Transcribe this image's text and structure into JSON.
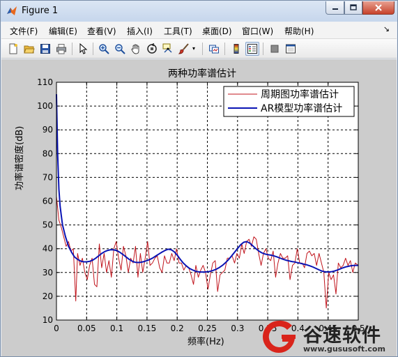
{
  "window": {
    "title": "Figure 1",
    "controls": {
      "minimize": "minimize",
      "maximize": "maximize",
      "close": "close"
    }
  },
  "menubar": {
    "items": [
      "文件(F)",
      "编辑(E)",
      "查看(V)",
      "插入(I)",
      "工具(T)",
      "桌面(D)",
      "窗口(W)",
      "帮助(H)"
    ]
  },
  "toolbar": {
    "buttons": [
      "new-file-icon",
      "open-folder-icon",
      "save-icon",
      "print-icon",
      "pointer-icon",
      "zoom-in-icon",
      "zoom-out-icon",
      "pan-hand-icon",
      "rotate-3d-icon",
      "data-cursor-icon",
      "brush-icon",
      "link-plot-icon",
      "colorbar-icon",
      "legend-icon",
      "hide-tools-icon",
      "show-tools-icon"
    ]
  },
  "chart_data": {
    "type": "line",
    "title": "两种功率谱估计",
    "xlabel": "频率(Hz)",
    "ylabel": "功率谱密度(dB)",
    "xlim": [
      0,
      0.5
    ],
    "ylim": [
      10,
      110
    ],
    "xticks": [
      "0",
      "0.05",
      "0.1",
      "0.15",
      "0.2",
      "0.25",
      "0.3",
      "0.35",
      "0.4",
      "0.45",
      "0.5"
    ],
    "yticks": [
      "10",
      "20",
      "30",
      "40",
      "50",
      "60",
      "70",
      "80",
      "90",
      "100",
      "110"
    ],
    "grid": true,
    "legend_position": "top-right",
    "series": [
      {
        "name": "周期图功率谱估计",
        "color": "#c0141c",
        "x": [
          0.0,
          0.004,
          0.008,
          0.012,
          0.016,
          0.02,
          0.024,
          0.028,
          0.032,
          0.035,
          0.039,
          0.043,
          0.047,
          0.051,
          0.055,
          0.059,
          0.063,
          0.067,
          0.071,
          0.075,
          0.079,
          0.083,
          0.087,
          0.091,
          0.095,
          0.099,
          0.103,
          0.107,
          0.111,
          0.115,
          0.119,
          0.123,
          0.127,
          0.131,
          0.135,
          0.139,
          0.143,
          0.147,
          0.151,
          0.155,
          0.159,
          0.163,
          0.167,
          0.171,
          0.175,
          0.179,
          0.183,
          0.187,
          0.191,
          0.195,
          0.199,
          0.203,
          0.207,
          0.211,
          0.215,
          0.219,
          0.223,
          0.227,
          0.231,
          0.235,
          0.239,
          0.243,
          0.247,
          0.251,
          0.255,
          0.259,
          0.263,
          0.267,
          0.271,
          0.275,
          0.279,
          0.283,
          0.287,
          0.291,
          0.295,
          0.299,
          0.303,
          0.307,
          0.311,
          0.315,
          0.319,
          0.323,
          0.327,
          0.331,
          0.335,
          0.339,
          0.343,
          0.347,
          0.351,
          0.355,
          0.359,
          0.363,
          0.367,
          0.371,
          0.375,
          0.379,
          0.383,
          0.387,
          0.391,
          0.395,
          0.399,
          0.403,
          0.407,
          0.411,
          0.415,
          0.419,
          0.423,
          0.427,
          0.431,
          0.435,
          0.439,
          0.443,
          0.447,
          0.451,
          0.455,
          0.459,
          0.463,
          0.467,
          0.471,
          0.475,
          0.479,
          0.483,
          0.487,
          0.491,
          0.495,
          0.5
        ],
        "y": [
          62,
          52,
          49,
          45,
          41,
          43,
          39,
          40,
          18,
          38,
          33,
          36,
          30,
          27,
          33,
          36,
          25,
          24,
          42,
          32,
          38,
          30,
          35,
          28,
          40,
          43,
          36,
          31,
          41,
          37,
          30,
          36,
          34,
          41,
          28,
          38,
          30,
          36,
          43,
          33,
          34,
          36,
          37,
          32,
          30,
          37,
          34,
          34,
          38,
          35,
          40,
          34,
          34,
          31,
          33,
          32,
          29,
          25,
          33,
          28,
          31,
          33,
          30,
          23,
          29,
          34,
          35,
          22,
          29,
          30,
          31,
          36,
          36,
          37,
          34,
          38,
          36,
          42,
          38,
          43,
          44,
          41,
          45,
          44,
          38,
          33,
          38,
          40,
          36,
          35,
          39,
          28,
          34,
          38,
          36,
          36,
          37,
          27,
          33,
          34,
          40,
          34,
          34,
          32,
          38,
          39,
          37,
          38,
          33,
          38,
          34,
          30,
          15,
          30,
          27,
          29,
          21,
          34,
          32,
          33,
          36,
          33,
          35,
          30,
          34,
          33
        ]
      },
      {
        "name": "AR模型功率谱估计",
        "color": "#0a14b4",
        "x": [
          0.0,
          0.002,
          0.004,
          0.006,
          0.008,
          0.01,
          0.015,
          0.02,
          0.025,
          0.03,
          0.035,
          0.04,
          0.045,
          0.05,
          0.055,
          0.06,
          0.065,
          0.07,
          0.075,
          0.08,
          0.085,
          0.09,
          0.095,
          0.1,
          0.105,
          0.11,
          0.115,
          0.12,
          0.125,
          0.13,
          0.135,
          0.14,
          0.145,
          0.15,
          0.155,
          0.16,
          0.165,
          0.17,
          0.175,
          0.18,
          0.185,
          0.19,
          0.195,
          0.2,
          0.205,
          0.21,
          0.215,
          0.22,
          0.225,
          0.23,
          0.235,
          0.24,
          0.245,
          0.25,
          0.255,
          0.26,
          0.265,
          0.27,
          0.275,
          0.28,
          0.285,
          0.29,
          0.295,
          0.3,
          0.305,
          0.31,
          0.315,
          0.32,
          0.325,
          0.33,
          0.335,
          0.34,
          0.345,
          0.35,
          0.355,
          0.36,
          0.365,
          0.37,
          0.375,
          0.38,
          0.385,
          0.39,
          0.395,
          0.4,
          0.405,
          0.41,
          0.415,
          0.42,
          0.425,
          0.43,
          0.435,
          0.44,
          0.445,
          0.45,
          0.455,
          0.46,
          0.465,
          0.47,
          0.475,
          0.48,
          0.485,
          0.49,
          0.495,
          0.5
        ],
        "y": [
          105,
          80,
          65,
          58,
          54,
          50,
          45,
          41,
          38.5,
          36.5,
          35.5,
          34.8,
          34.5,
          34.5,
          34.7,
          35.2,
          36,
          37,
          38,
          38.8,
          39.3,
          39.6,
          39.5,
          39.2,
          38.5,
          37.6,
          36.6,
          35.6,
          34.8,
          34.3,
          34.2,
          34.3,
          34.6,
          35,
          35.5,
          36.2,
          37,
          37.8,
          38.6,
          39.3,
          39.8,
          39.6,
          38.7,
          37.3,
          35.6,
          34,
          32.8,
          31.8,
          31.1,
          30.6,
          30.3,
          30.2,
          30.2,
          30.3,
          30.5,
          30.9,
          31.4,
          32.1,
          33,
          34.1,
          35.4,
          36.9,
          38.5,
          40.1,
          41.6,
          42.7,
          43,
          42.4,
          41.3,
          40.1,
          39.1,
          38.3,
          37.8,
          37.5,
          37.3,
          37,
          36.6,
          36.1,
          35.6,
          35.2,
          34.9,
          34.6,
          34.4,
          34.1,
          33.8,
          33.5,
          33.2,
          32.8,
          32.3,
          31.7,
          31.1,
          30.6,
          30.3,
          30.2,
          30.3,
          30.6,
          31,
          31.5,
          32,
          32.4,
          32.7,
          32.9,
          33,
          33
        ]
      }
    ]
  },
  "watermark": {
    "brand": "谷速软件",
    "url": "www.gususoft.com"
  },
  "colors": {
    "titlebar": "#c6d6ec",
    "figure_background": "#cccccc",
    "axes_background": "#ffffff",
    "close_button": "#c7432c",
    "watermark_logo": "#d9241b"
  }
}
